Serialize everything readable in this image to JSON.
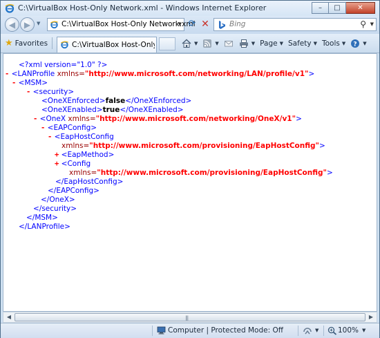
{
  "window": {
    "title": "C:\\VirtualBox Host-Only Network.xml - Windows Internet Explorer",
    "controls": {
      "minimize": "–",
      "maximize": "□",
      "close": "✕"
    }
  },
  "address_bar": {
    "url": "C:\\VirtualBox Host-Only Network.xml",
    "search_placeholder": "Bing"
  },
  "favorites_bar": {
    "favorites_label": "Favorites",
    "tab_title": "C:\\VirtualBox Host-Only Net..."
  },
  "command_bar": {
    "page_label": "Page",
    "safety_label": "Safety",
    "tools_label": "Tools"
  },
  "xml": {
    "decl": "<?xml version=\"1.0\" ?>",
    "collapse": "-",
    "expand": "+",
    "lanprofile_open": "<LANProfile",
    "xmlns_attr": "xmlns=",
    "lan_ns": "\"http://www.microsoft.com/networking/LAN/profile/v1\"",
    "gt": ">",
    "msm_open": "<MSM>",
    "security_open": "<security>",
    "onex_enforced_open": "<OneXEnforced>",
    "onex_enforced_val": "false",
    "onex_enforced_close": "</OneXEnforced>",
    "onex_enabled_open": "<OneXEnabled>",
    "onex_enabled_val": "true",
    "onex_enabled_close": "</OneXEnabled>",
    "onex_open": "<OneX",
    "onex_ns": "\"http://www.microsoft.com/networking/OneX/v1\"",
    "eapconfig_open": "<EAPConfig>",
    "eaphostconfig_open": "<EapHostConfig",
    "eaphost_ns": "\"http://www.microsoft.com/provisioning/EapHostConfig\"",
    "eapmethod_open": "<EapMethod>",
    "config_open": "<Config",
    "eaphostconfig_close": "</EapHostConfig>",
    "eapconfig_close": "</EAPConfig>",
    "onex_close": "</OneX>",
    "security_close": "</security>",
    "msm_close": "</MSM>",
    "lanprofile_close": "</LANProfile>"
  },
  "status_bar": {
    "zone": "Computer | Protected Mode: Off",
    "zoom": "100%"
  },
  "colors": {
    "markup_blue": "#0000ff",
    "tag_name": "#990000",
    "attr_value": "#ff0000"
  }
}
